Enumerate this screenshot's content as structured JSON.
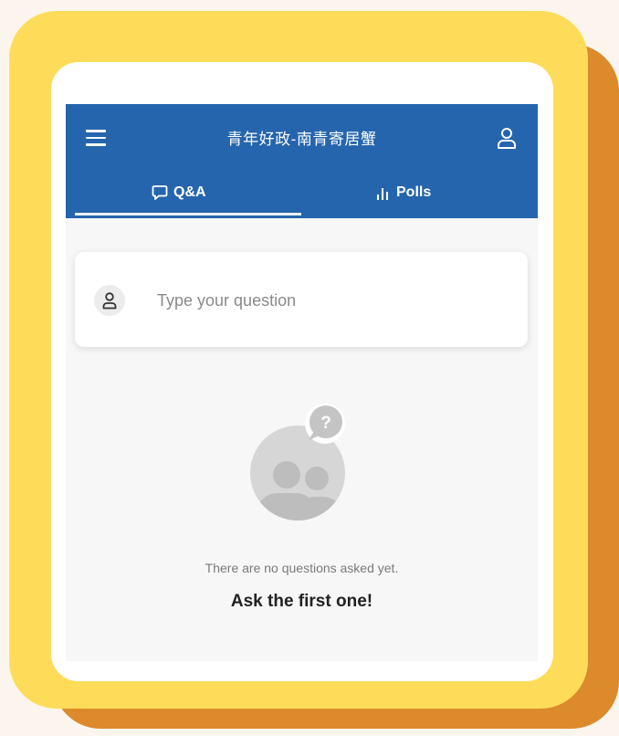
{
  "header": {
    "title": "青年好政-南青寄居蟹",
    "background_color": "#2565ad"
  },
  "tabs": [
    {
      "label": "Q&A",
      "icon": "chat-bubble-icon",
      "active": true
    },
    {
      "label": "Polls",
      "icon": "bar-chart-icon",
      "active": false
    }
  ],
  "question_box": {
    "placeholder": "Type your question",
    "value": ""
  },
  "empty_state": {
    "icon": "people-question-icon",
    "message": "There are no questions asked yet.",
    "cta": "Ask the first one!"
  },
  "theme": {
    "page_background": "#fbf5ee",
    "frame_color": "#fedc5a",
    "frame_shadow_color": "#dd8a2c"
  }
}
